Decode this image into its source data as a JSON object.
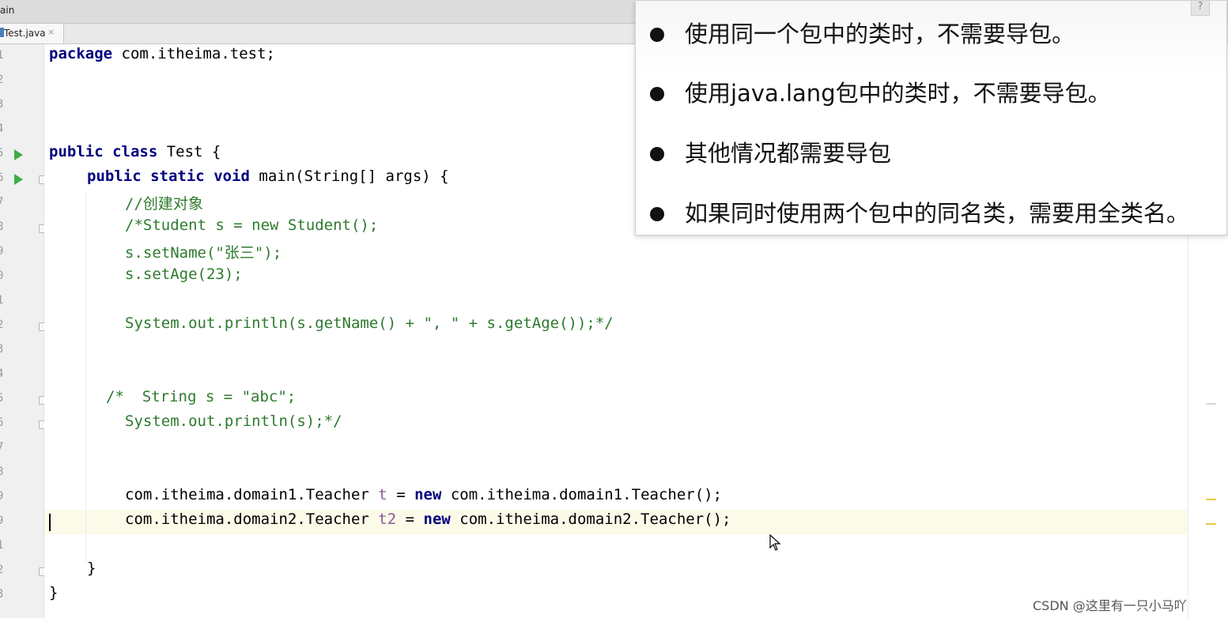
{
  "window": {
    "title": "ain"
  },
  "tab": {
    "label": "Test.java",
    "close": "×"
  },
  "editor": {
    "line_numbers": [
      "1",
      "2",
      "3",
      "4",
      "5",
      "6",
      "7",
      "8",
      "9",
      "0",
      "1",
      "2",
      "3",
      "4",
      "5",
      "6",
      "7",
      "8",
      "9",
      "9",
      "1",
      "2",
      "3"
    ],
    "code": {
      "l1": {
        "kw": "package",
        "rest": " com.itheima.test;"
      },
      "l5": {
        "kw1": "public",
        "kw2": "class",
        "rest": " Test {"
      },
      "l6": {
        "kw1": "public",
        "kw2": "static",
        "kw3": "void",
        "rest": " main(String[] args) {"
      },
      "l7": "//创建对象",
      "l8": "/*Student s = new Student();",
      "l9": "s.setName(\"张三\");",
      "l10": "s.setAge(23);",
      "l12": "System.out.println(s.getName() + \", \" + s.getAge());*/",
      "l15": "/*  String s = \"abc\";",
      "l16": "System.out.println(s);*/",
      "l19": {
        "type": "com.itheima.domain1.Teacher ",
        "var": "t",
        "eq": " = ",
        "kw": "new",
        "rest": " com.itheima.domain1.Teacher();"
      },
      "l20": {
        "type": "com.itheima.domain2.Teacher ",
        "var": "t2",
        "eq": " = ",
        "kw": "new",
        "rest": " com.itheima.domain2.Teacher();"
      },
      "l22": "}",
      "l23": "}"
    }
  },
  "overlay": {
    "bullets": [
      "使用同一个包中的类时，不需要导包。",
      "使用java.lang包中的类时，不需要导包。",
      "其他情况都需要导包",
      "如果同时使用两个包中的同名类，需要用全类名。"
    ]
  },
  "help": "?",
  "watermark": "CSDN @这里有一只小马吖",
  "colors": {
    "keyword": "#000080",
    "comment": "#2e7a2e",
    "field": "#8a5a98",
    "run": "#3cae47",
    "current_line": "#fcfae9"
  }
}
